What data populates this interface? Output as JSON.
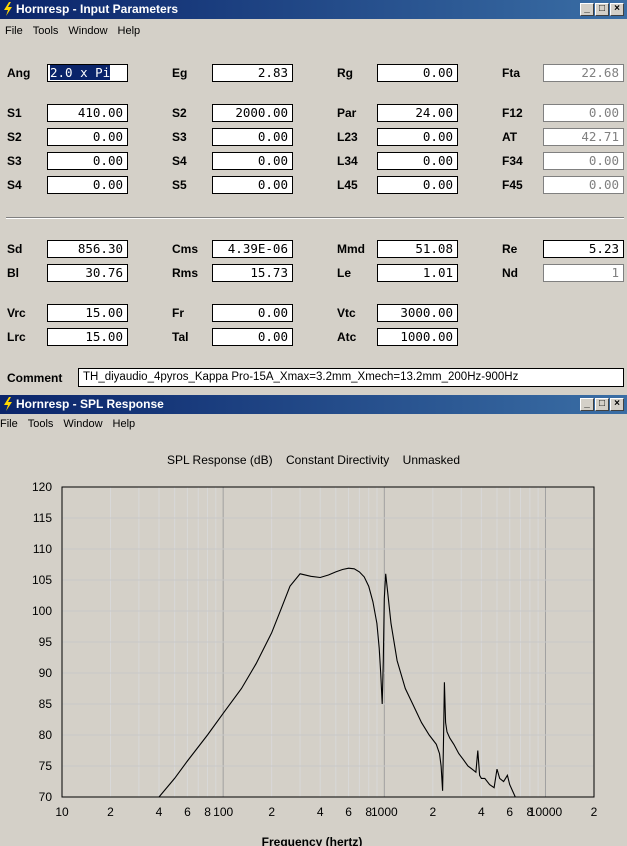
{
  "input_window": {
    "title": "Hornresp - Input Parameters",
    "menu": [
      "File",
      "Tools",
      "Window",
      "Help"
    ],
    "fields": {
      "Ang": "2.0 x Pi",
      "Eg": "2.83",
      "Rg": "0.00",
      "Fta": "22.68",
      "S1": "410.00",
      "S2a": "2000.00",
      "Par": "24.00",
      "F12": "0.00",
      "S2": "0.00",
      "S3a": "0.00",
      "L23": "0.00",
      "AT": "42.71",
      "S3": "0.00",
      "S4a": "0.00",
      "L34": "0.00",
      "F34": "0.00",
      "S4": "0.00",
      "S5": "0.00",
      "L45": "0.00",
      "F45": "0.00",
      "Sd": "856.30",
      "Cms": "4.39E-06",
      "Mmd": "51.08",
      "Re": "5.23",
      "Bl": "30.76",
      "Rms": "15.73",
      "Le": "1.01",
      "Nd": "1",
      "Vrc": "15.00",
      "Fr": "0.00",
      "Vtc": "3000.00",
      "Lrc": "15.00",
      "Tal": "0.00",
      "Atc": "1000.00"
    },
    "labels": {
      "Ang": "Ang",
      "Eg": "Eg",
      "Rg": "Rg",
      "Fta": "Fta",
      "S1": "S1",
      "S2a": "S2",
      "Par": "Par",
      "F12": "F12",
      "S2": "S2",
      "S3a": "S3",
      "L23": "L23",
      "AT": "AT",
      "S3": "S3",
      "S4a": "S4",
      "L34": "L34",
      "F34": "F34",
      "S4": "S4",
      "S5": "S5",
      "L45": "L45",
      "F45": "F45",
      "Sd": "Sd",
      "Cms": "Cms",
      "Mmd": "Mmd",
      "Re": "Re",
      "Bl": "Bl",
      "Rms": "Rms",
      "Le": "Le",
      "Nd": "Nd",
      "Vrc": "Vrc",
      "Fr": "Fr",
      "Vtc": "Vtc",
      "Lrc": "Lrc",
      "Tal": "Tal",
      "Atc": "Atc"
    },
    "comment_label": "Comment",
    "comment": "TH_diyaudio_4pyros_Kappa Pro-15A_Xmax=3.2mm_Xmech=13.2mm_200Hz-900Hz"
  },
  "spl_window": {
    "title": "Hornresp - SPL Response",
    "menu": [
      "File",
      "Tools",
      "Window",
      "Help"
    ],
    "chart_title_parts": [
      "SPL Response (dB)",
      "Constant Directivity",
      "Unmasked"
    ]
  },
  "chart_data": {
    "type": "line",
    "title": "SPL Response (dB)   Constant Directivity   Unmasked",
    "xlabel": "Frequency (hertz)",
    "ylabel": "",
    "xscale": "log",
    "xlim": [
      10,
      20000
    ],
    "ylim": [
      70,
      120
    ],
    "yticks": [
      70,
      75,
      80,
      85,
      90,
      95,
      100,
      105,
      110,
      115,
      120
    ],
    "xtick_labels": [
      {
        "x": 10,
        "label": "10"
      },
      {
        "x": 20,
        "label": "2"
      },
      {
        "x": 40,
        "label": "4"
      },
      {
        "x": 60,
        "label": "6"
      },
      {
        "x": 80,
        "label": "8"
      },
      {
        "x": 100,
        "label": "100"
      },
      {
        "x": 200,
        "label": "2"
      },
      {
        "x": 400,
        "label": "4"
      },
      {
        "x": 600,
        "label": "6"
      },
      {
        "x": 800,
        "label": "8"
      },
      {
        "x": 1000,
        "label": "1000"
      },
      {
        "x": 2000,
        "label": "2"
      },
      {
        "x": 4000,
        "label": "4"
      },
      {
        "x": 6000,
        "label": "6"
      },
      {
        "x": 8000,
        "label": "8"
      },
      {
        "x": 10000,
        "label": "10000"
      },
      {
        "x": 20000,
        "label": "2"
      }
    ],
    "grid": true,
    "series": [
      {
        "color": "#000000",
        "x": [
          40,
          50,
          60,
          80,
          100,
          130,
          160,
          200,
          230,
          260,
          300,
          350,
          400,
          450,
          500,
          550,
          600,
          650,
          700,
          750,
          800,
          850,
          900,
          930,
          950,
          970,
          985,
          1000,
          1020,
          1050,
          1100,
          1200,
          1350,
          1500,
          1700,
          1900,
          2100,
          2200,
          2250,
          2300,
          2330,
          2360,
          2400,
          2450,
          2550,
          2700,
          2900,
          3100,
          3300,
          3500,
          3700,
          3800,
          3900,
          4000,
          4200,
          4500,
          4800,
          5000,
          5200,
          5500,
          5800,
          6000,
          6500
        ],
        "y": [
          70,
          73,
          75.8,
          80,
          83.5,
          87.5,
          91.5,
          96.5,
          100.5,
          104,
          106,
          105.6,
          105.4,
          105.8,
          106.3,
          106.7,
          106.9,
          106.8,
          106.3,
          105.5,
          104,
          101.5,
          98,
          94,
          90,
          85,
          92,
          102,
          106,
          103,
          98,
          92,
          87.5,
          85,
          82,
          80,
          78.5,
          77,
          75,
          71,
          79,
          88.5,
          82,
          80.5,
          79.5,
          78.5,
          77,
          76,
          75,
          74.5,
          74,
          77.5,
          73.5,
          73,
          73,
          72,
          71.5,
          74.5,
          73,
          72.5,
          73.5,
          72,
          70
        ]
      }
    ]
  }
}
